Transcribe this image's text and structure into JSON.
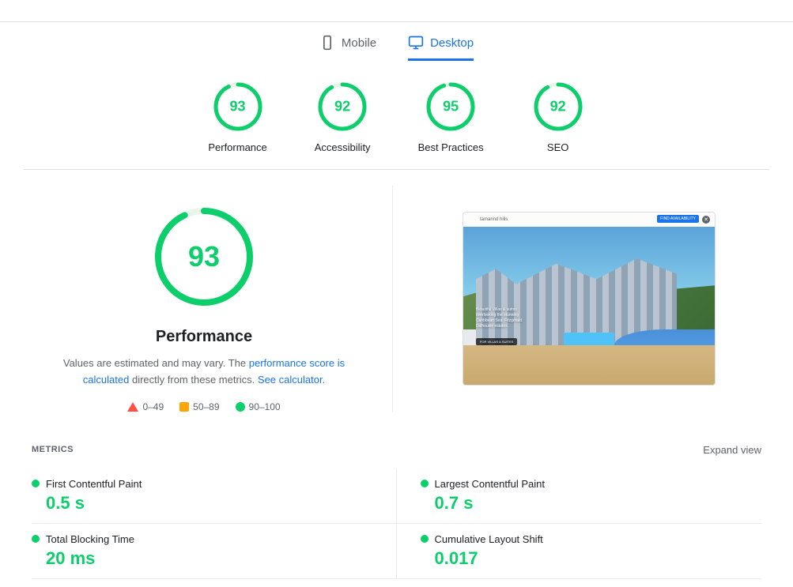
{
  "header": {
    "tabs": [
      {
        "id": "mobile",
        "label": "Mobile",
        "active": false,
        "icon": "mobile-icon"
      },
      {
        "id": "desktop",
        "label": "Desktop",
        "active": true,
        "icon": "desktop-icon"
      }
    ]
  },
  "scores": [
    {
      "id": "performance",
      "label": "Performance",
      "value": "93",
      "color": "#0cce6b"
    },
    {
      "id": "accessibility",
      "label": "Accessibility",
      "value": "92",
      "color": "#0cce6b"
    },
    {
      "id": "best-practices",
      "label": "Best Practices",
      "value": "95",
      "color": "#0cce6b"
    },
    {
      "id": "seo",
      "label": "SEO",
      "value": "92",
      "color": "#0cce6b"
    }
  ],
  "main": {
    "big_score": "93",
    "big_score_label": "Performance",
    "description_text": "Values are estimated and may vary. The",
    "description_link1": "performance score is calculated",
    "description_text2": "directly from these metrics.",
    "description_link2": "See calculator.",
    "legend": [
      {
        "id": "fail",
        "range": "0–49",
        "shape": "triangle",
        "color": "#ff4e42"
      },
      {
        "id": "average",
        "range": "50–89",
        "shape": "square",
        "color": "#ffa400"
      },
      {
        "id": "pass",
        "range": "90–100",
        "shape": "circle",
        "color": "#0cce6b"
      }
    ]
  },
  "metrics": {
    "title": "METRICS",
    "expand_label": "Expand view",
    "items": [
      {
        "id": "fcp",
        "label": "First Contentful Paint",
        "value": "0.5 s",
        "status": "green"
      },
      {
        "id": "lcp",
        "label": "Largest Contentful Paint",
        "value": "0.7 s",
        "status": "green"
      },
      {
        "id": "tbt",
        "label": "Total Blocking Time",
        "value": "20 ms",
        "status": "green"
      },
      {
        "id": "cls",
        "label": "Cumulative Layout Shift",
        "value": "0.017",
        "status": "green"
      }
    ]
  }
}
